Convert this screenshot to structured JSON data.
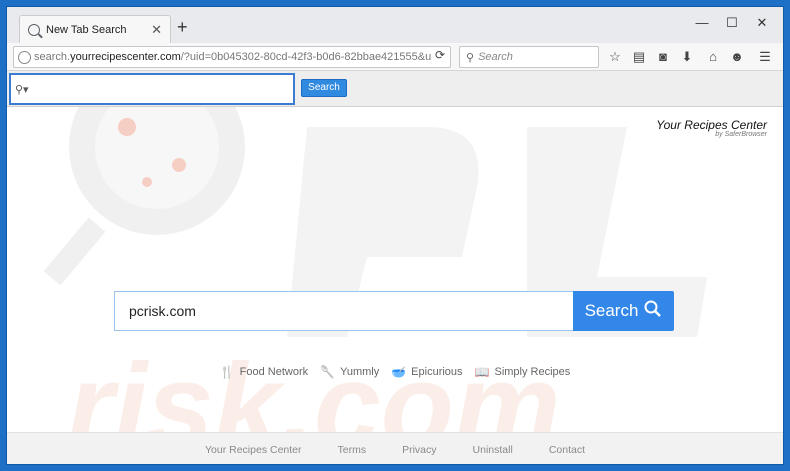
{
  "window": {
    "tab_title": "New Tab Search",
    "new_tab": "+",
    "minimize": "—",
    "maximize": "☐",
    "close": "✕"
  },
  "nav": {
    "url_prefix": "search.",
    "url_domain": "yourrecipescenter.com",
    "url_rest": "/?uid=0b045302-80cd-42f3-b0d6-82bbae421555&u",
    "search_placeholder": "Search",
    "reload_icon": "⟳",
    "icons": [
      "star-icon",
      "reader-icon",
      "pocket-icon",
      "download-icon",
      "home-icon",
      "smiley-icon",
      "menu-icon"
    ]
  },
  "extension": {
    "input_value": "",
    "button_label": "Search"
  },
  "brand": {
    "name": "Your Recipes Center",
    "sub": "by SaferBrowser"
  },
  "main": {
    "search_value": "pcrisk.com",
    "search_button": "Search"
  },
  "quick_links": [
    {
      "label": "Food Network",
      "icon": "fork-knife-icon"
    },
    {
      "label": "Yummly",
      "icon": "spoon-icon"
    },
    {
      "label": "Epicurious",
      "icon": "ladle-icon"
    },
    {
      "label": "Simply Recipes",
      "icon": "book-icon"
    }
  ],
  "footer": [
    "Your Recipes Center",
    "Terms",
    "Privacy",
    "Uninstall",
    "Contact"
  ],
  "colors": {
    "accent": "#3387e8",
    "border_blue": "#1e6fc6",
    "watermark": "#f3d9d0"
  }
}
